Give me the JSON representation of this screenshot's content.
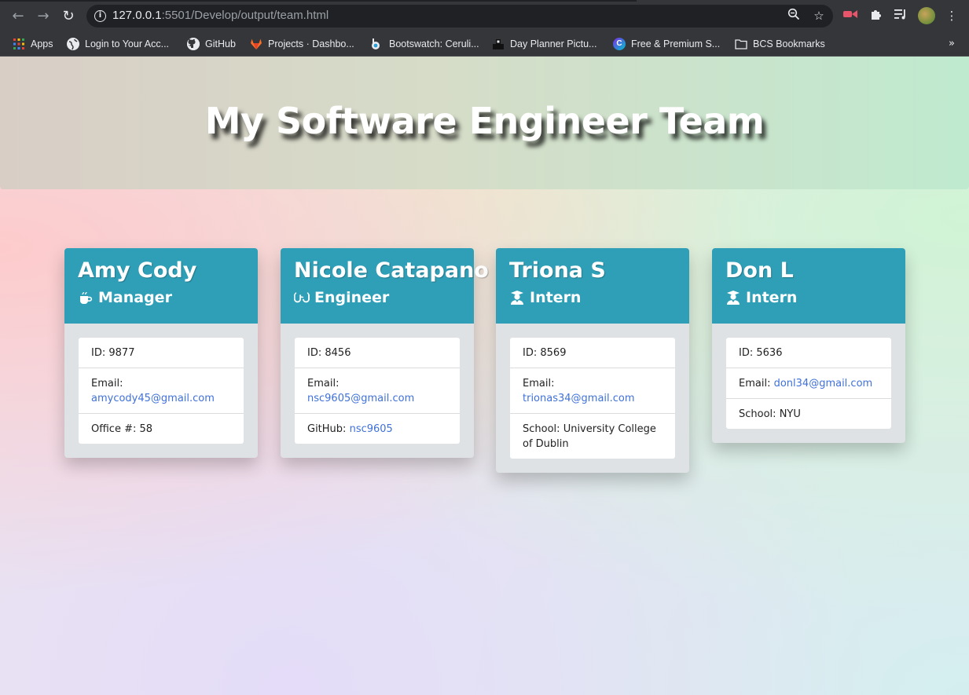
{
  "browser": {
    "url_host": "127.0.0.1",
    "url_rest": ":5501/Develop/output/team.html",
    "bookmarks": [
      {
        "label": "Apps",
        "icon": "apps-grid-icon"
      },
      {
        "label": "Login to Your Acc...",
        "icon": "globe-icon"
      },
      {
        "label": "GitHub",
        "icon": "github-icon"
      },
      {
        "label": "Projects · Dashbo...",
        "icon": "gitlab-icon"
      },
      {
        "label": "Bootswatch: Ceruli...",
        "icon": "bootswatch-icon"
      },
      {
        "label": "Day Planner Pictu...",
        "icon": "planner-icon"
      },
      {
        "label": "Free & Premium S...",
        "icon": "canva-icon"
      },
      {
        "label": "BCS Bookmarks",
        "icon": "folder-icon"
      }
    ]
  },
  "page": {
    "title": "My Software Engineer Team"
  },
  "team": [
    {
      "name": "Amy Cody",
      "role": "Manager",
      "role_icon": "coffee-mug-icon",
      "id_label": "ID:",
      "id": "9877",
      "email_label": "Email:",
      "email": "amycody45@gmail.com",
      "extra_label": "Office #:",
      "extra": "58"
    },
    {
      "name": "Nicole Catapano",
      "role": "Engineer",
      "role_icon": "glasses-icon",
      "id_label": "ID:",
      "id": "8456",
      "email_label": "Email:",
      "email": "nsc9605@gmail.com",
      "extra_label": "GitHub:",
      "extra": "nsc9605"
    },
    {
      "name": "Triona S",
      "role": "Intern",
      "role_icon": "graduate-icon",
      "id_label": "ID:",
      "id": "8569",
      "email_label": "Email:",
      "email": "trionas34@gmail.com",
      "extra_label": "School:",
      "extra": "University College of Dublin"
    },
    {
      "name": "Don L",
      "role": "Intern",
      "role_icon": "graduate-icon",
      "id_label": "ID:",
      "id": "5636",
      "email_label": "Email:",
      "email": "donl34@gmail.com",
      "extra_label": "School:",
      "extra": "NYU"
    }
  ]
}
